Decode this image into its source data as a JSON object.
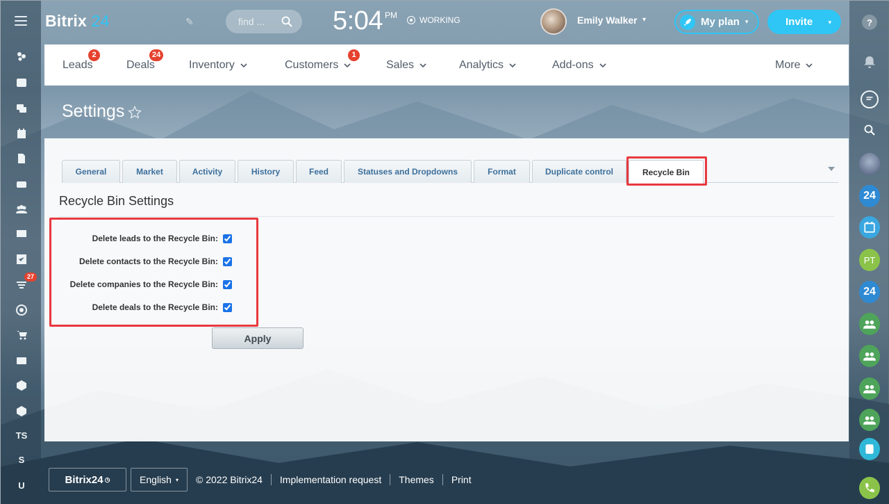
{
  "app": {
    "brand": "Bitrix",
    "brand_num": "24"
  },
  "header": {
    "search_placeholder": "find ...",
    "clock_time": "5:04",
    "clock_ampm": "PM",
    "status": "WORKING",
    "user_name": "Emily Walker",
    "myplan_label": "My plan",
    "invite_label": "Invite"
  },
  "left_sidebar": {
    "badge": "27",
    "text_items": [
      "TS",
      "S",
      "U"
    ]
  },
  "top_menu": {
    "items": [
      {
        "label": "Leads",
        "badge": "2"
      },
      {
        "label": "Deals",
        "badge": "24"
      },
      {
        "label": "Inventory"
      },
      {
        "label": "Customers",
        "badge": "1"
      },
      {
        "label": "Sales"
      },
      {
        "label": "Analytics"
      },
      {
        "label": "Add-ons"
      },
      {
        "label": "More"
      }
    ]
  },
  "page": {
    "title": "Settings"
  },
  "tabs": [
    {
      "label": "General"
    },
    {
      "label": "Market"
    },
    {
      "label": "Activity"
    },
    {
      "label": "History"
    },
    {
      "label": "Feed"
    },
    {
      "label": "Statuses and Dropdowns"
    },
    {
      "label": "Format"
    },
    {
      "label": "Duplicate control"
    },
    {
      "label": "Recycle Bin",
      "active": true
    }
  ],
  "recycle_bin": {
    "title": "Recycle Bin Settings",
    "options": [
      {
        "label": "Delete leads to the Recycle Bin:",
        "checked": true
      },
      {
        "label": "Delete contacts to the Recycle Bin:",
        "checked": true
      },
      {
        "label": "Delete companies to the Recycle Bin:",
        "checked": true
      },
      {
        "label": "Delete deals to the Recycle Bin:",
        "checked": true
      }
    ],
    "apply_label": "Apply"
  },
  "right_bar": {
    "badge_24": "24",
    "initials": "PT"
  },
  "footer": {
    "logo_text": "Bitrix24",
    "language": "English",
    "copyright": "© 2022 Bitrix24",
    "links": [
      "Implementation request",
      "Themes",
      "Print"
    ]
  },
  "colors": {
    "accent": "#2fc6f6",
    "highlight": "#e8393f",
    "badge": "#e5422e",
    "tab_text": "#3d6f9b"
  }
}
